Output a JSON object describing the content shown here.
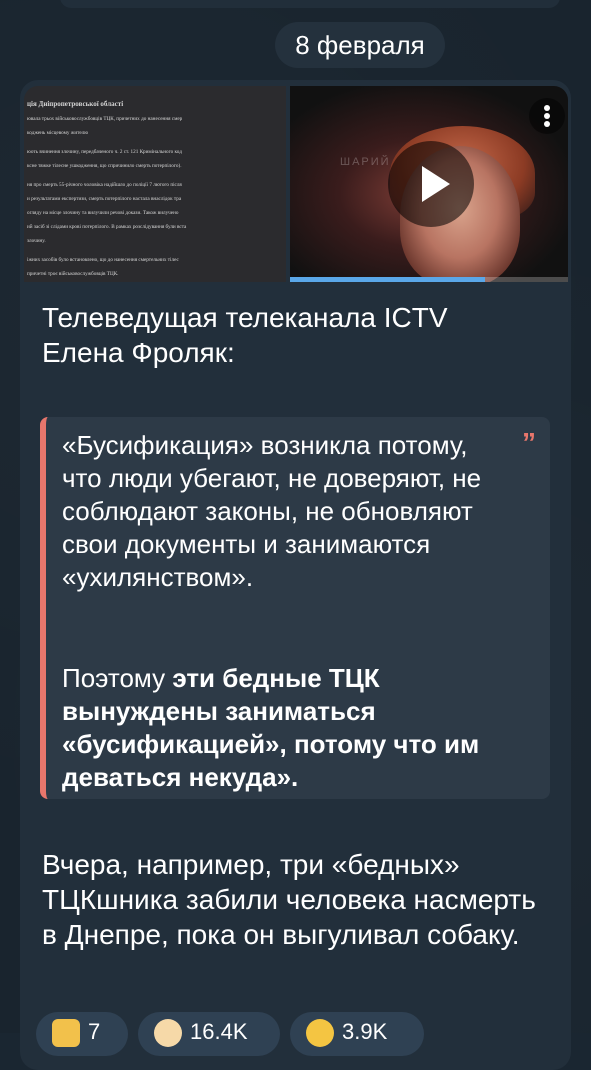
{
  "date_separator": "8 февраля",
  "media": {
    "document_lines": [
      "ція Дніпропетровської області",
      "ювала трьох військовослужбовців ТЦК, причетних до нанесення смер",
      "коджень місцевому жителю",
      "юоть вчинення злочину, передбаченого ч. 2 ст. 121 Кримінального код",
      "ксне тяжке тілесне ушкодження, що спричинило смерть потерпілого).",
      "ня про смерть 55-річного чоловіка надійшло до поліції 7 лютого після",
      "и результатами експертизи, смерть потерпілого настала внаслідок тра",
      "огляду на місце злочину та вилучили речові докази. Також вилучено",
      "ий засіб зі слідами крові потерпілого. В рамках розслідування були вста",
      "злочину.",
      "іжних засобів було встановлено, що до нанесення смертельних тілес",
      "причетні троє військовослужбовців ТЦК.",
      "н, наразі тривас досудове розслідування. Встановлюються всі обставин"
    ],
    "video_watermark": "ШАРИЙ",
    "video_progress": 0.7
  },
  "message": {
    "intro_line1": "Телеведущая телеканала ICTV",
    "intro_line2": "Елена Фроляк:",
    "quote_mark": "”",
    "quote_p1": "«Бусификация» возникла потому, что люди убегают, не доверяют, не соблюдают законы, не обновляют свои документы и занимаются «ухилянством».",
    "quote_p2_plain": "Поэтому ",
    "quote_p2_bold": "эти бедные ТЦК вынуждены заниматься «бусификацией», потому что им деваться некуда».",
    "outro": "Вчера, например, три «бедных» ТЦКшника забили человека насмерть в Днепре, пока он выгуливал собаку."
  },
  "reactions": [
    {
      "emoji": "thumbs-up-icon",
      "count": "7"
    },
    {
      "emoji": "clown-face-icon",
      "count": "16.4K"
    },
    {
      "emoji": "crying-face-icon",
      "count": "3.9K"
    }
  ],
  "colors": {
    "background": "#19242e",
    "bubble": "#222f3b",
    "quote_background": "#2d3a47",
    "quote_accent": "#e8766c",
    "reaction_pill": "#2f4153",
    "progress": "#5aa7e8"
  }
}
